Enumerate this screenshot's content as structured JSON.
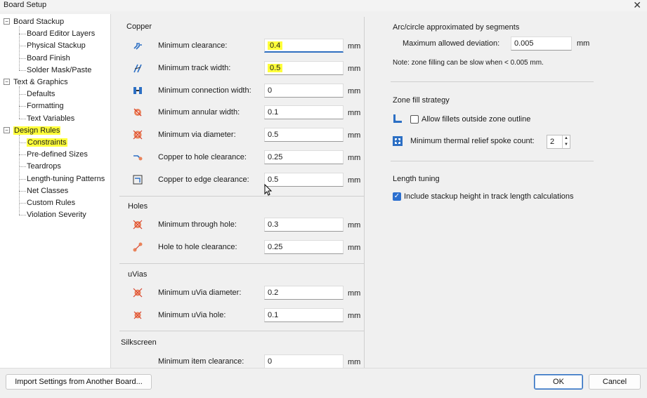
{
  "window": {
    "title": "Board Setup",
    "close_glyph": "✕"
  },
  "tree": {
    "items": [
      {
        "label": "Board Stackup",
        "level": 0,
        "expanded": true
      },
      {
        "label": "Board Editor Layers",
        "level": 1
      },
      {
        "label": "Physical Stackup",
        "level": 1
      },
      {
        "label": "Board Finish",
        "level": 1
      },
      {
        "label": "Solder Mask/Paste",
        "level": 1
      },
      {
        "label": "Text & Graphics",
        "level": 0,
        "expanded": true
      },
      {
        "label": "Defaults",
        "level": 1
      },
      {
        "label": "Formatting",
        "level": 1
      },
      {
        "label": "Text Variables",
        "level": 1
      },
      {
        "label": "Design Rules",
        "level": 0,
        "expanded": true,
        "highlighted": true
      },
      {
        "label": "Constraints",
        "level": 1,
        "highlighted": true,
        "selected": true
      },
      {
        "label": "Pre-defined Sizes",
        "level": 1
      },
      {
        "label": "Teardrops",
        "level": 1
      },
      {
        "label": "Length-tuning Patterns",
        "level": 1
      },
      {
        "label": "Net Classes",
        "level": 1
      },
      {
        "label": "Custom Rules",
        "level": 1
      },
      {
        "label": "Violation Severity",
        "level": 1
      }
    ],
    "toggle_glyph": "−"
  },
  "copper": {
    "title": "Copper",
    "rows": [
      {
        "label": "Minimum clearance:",
        "value": "0.4",
        "unit": "mm",
        "icon": "clearance-icon",
        "highlighted": true,
        "focused": true
      },
      {
        "label": "Minimum track width:",
        "value": "0.5",
        "unit": "mm",
        "icon": "track-width-icon",
        "highlighted": true
      },
      {
        "label": "Minimum connection width:",
        "value": "0",
        "unit": "mm",
        "icon": "connection-width-icon"
      },
      {
        "label": "Minimum annular width:",
        "value": "0.1",
        "unit": "mm",
        "icon": "annular-width-icon"
      },
      {
        "label": "Minimum via diameter:",
        "value": "0.5",
        "unit": "mm",
        "icon": "via-diameter-icon"
      },
      {
        "label": "Copper to hole clearance:",
        "value": "0.25",
        "unit": "mm",
        "icon": "copper-hole-clearance-icon"
      },
      {
        "label": "Copper to edge clearance:",
        "value": "0.5",
        "unit": "mm",
        "icon": "copper-edge-clearance-icon"
      }
    ]
  },
  "holes": {
    "title": "Holes",
    "rows": [
      {
        "label": "Minimum through hole:",
        "value": "0.3",
        "unit": "mm",
        "icon": "through-hole-icon"
      },
      {
        "label": "Hole to hole clearance:",
        "value": "0.25",
        "unit": "mm",
        "icon": "hole-hole-clearance-icon"
      }
    ]
  },
  "uvias": {
    "title": "uVias",
    "rows": [
      {
        "label": "Minimum uVia diameter:",
        "value": "0.2",
        "unit": "mm",
        "icon": "uvia-diameter-icon"
      },
      {
        "label": "Minimum uVia hole:",
        "value": "0.1",
        "unit": "mm",
        "icon": "uvia-hole-icon"
      }
    ]
  },
  "silkscreen": {
    "title": "Silkscreen",
    "rows": [
      {
        "label": "Minimum item clearance:",
        "value": "0",
        "unit": "mm"
      }
    ]
  },
  "arc": {
    "title": "Arc/circle approximated by segments",
    "max_dev_label": "Maximum allowed deviation:",
    "max_dev_value": "0.005",
    "max_dev_unit": "mm",
    "note": "Note: zone filling can be slow when < 0.005 mm."
  },
  "zone_fill": {
    "title": "Zone fill strategy",
    "fillets_label": "Allow fillets outside zone outline",
    "fillets_checked": false,
    "spoke_label": "Minimum thermal relief spoke count:",
    "spoke_value": "2"
  },
  "length_tuning": {
    "title": "Length tuning",
    "stackup_label": "Include stackup height in track length calculations",
    "stackup_checked": true
  },
  "footer": {
    "import_label": "Import Settings from Another Board...",
    "ok_label": "OK",
    "cancel_label": "Cancel"
  },
  "colors": {
    "highlight": "#ffff3a",
    "accent": "#2f6fc0",
    "icon_red": "#d9412b",
    "icon_blue": "#2c6fc4"
  }
}
